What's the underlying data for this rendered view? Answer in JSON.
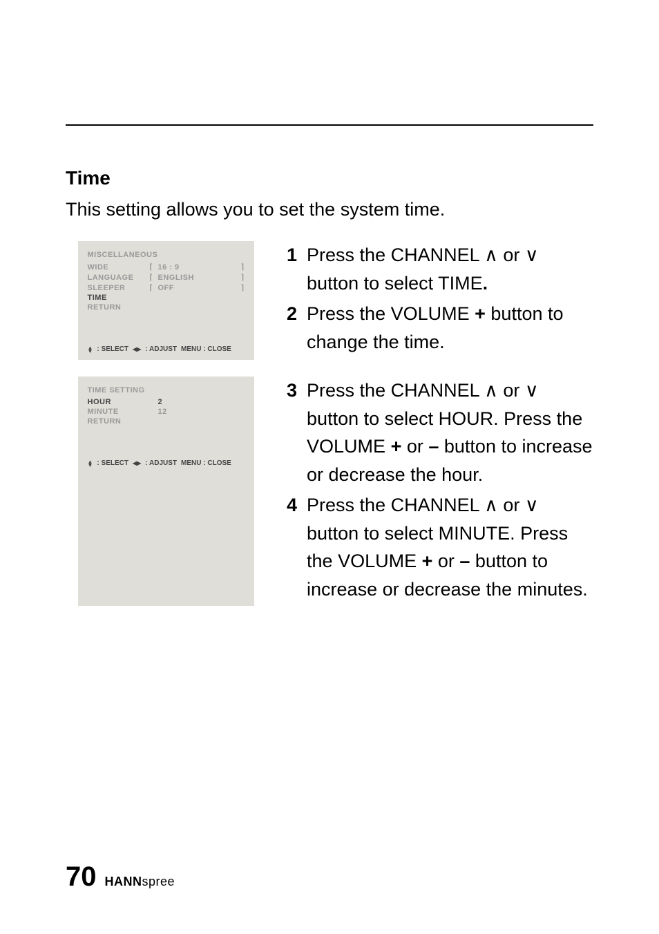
{
  "section": {
    "title": "Time",
    "intro": "This setting allows you to set the system time."
  },
  "osd1": {
    "title": "MISCELLANEOUS",
    "rows": [
      {
        "label": "WIDE",
        "value": "16 : 9",
        "bracket": true,
        "highlight": false
      },
      {
        "label": "LANGUAGE",
        "value": "ENGLISH",
        "bracket": true,
        "highlight": false
      },
      {
        "label": "SLEEPER",
        "value": "OFF",
        "bracket": true,
        "highlight": false
      },
      {
        "label": "TIME",
        "value": "",
        "bracket": false,
        "highlight": true
      },
      {
        "label": "RETURN",
        "value": "",
        "bracket": false,
        "highlight": false
      }
    ],
    "footer": {
      "select": ": SELECT",
      "adjust": ": ADJUST",
      "close": "MENU : CLOSE"
    }
  },
  "osd2": {
    "title": "TIME SETTING",
    "rows": [
      {
        "label": "HOUR",
        "value": "2",
        "bracket": false,
        "highlight": true
      },
      {
        "label": "MINUTE",
        "value": "12",
        "bracket": false,
        "highlight": false
      },
      {
        "label": "RETURN",
        "value": "",
        "bracket": false,
        "highlight": false
      }
    ],
    "footer": {
      "select": ": SELECT",
      "adjust": ": ADJUST",
      "close": "MENU : CLOSE"
    }
  },
  "stepsA": {
    "s1": {
      "num": "1",
      "pre": "Press the CHANNEL ",
      "up": "∧",
      "mid": " or ",
      "down": "∨",
      "post": " button to select TIME",
      "period": "."
    },
    "s2": {
      "num": "2",
      "pre": "Press the VOLUME ",
      "plus": "+",
      "post": " button to change the time."
    }
  },
  "stepsB": {
    "s3": {
      "num": "3",
      "pre": "Press the CHANNEL ",
      "up": "∧",
      "mid1": " or ",
      "down": "∨",
      "post1": " button to select HOUR. Press the VOLUME ",
      "plus": "+",
      "mid2": " or ",
      "minus": "–",
      "post2": " button to increase or decrease the hour."
    },
    "s4": {
      "num": "4",
      "pre": "Press the CHANNEL ",
      "up": "∧",
      "mid1": " or ",
      "down": "∨",
      "post1": " button to select MINUTE. Press the VOLUME ",
      "plus": "+",
      "mid2": " or ",
      "minus": "–",
      "post2": " button to increase or decrease the minutes."
    }
  },
  "footer": {
    "page": "70",
    "brand_bold": "HANN",
    "brand_light": "spree"
  }
}
